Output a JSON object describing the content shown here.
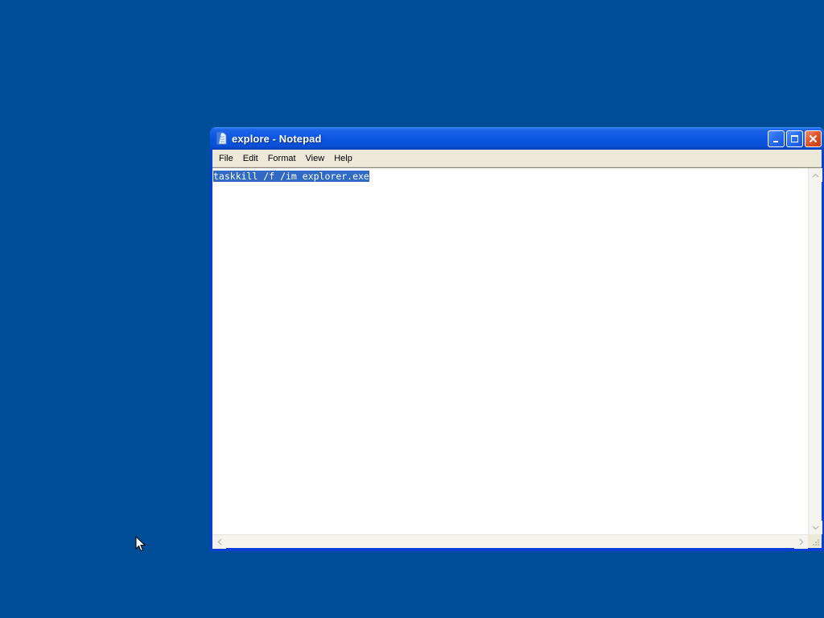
{
  "window": {
    "title": "explore - Notepad",
    "icon": "notepad-icon"
  },
  "menu": {
    "items": [
      "File",
      "Edit",
      "Format",
      "View",
      "Help"
    ]
  },
  "editor": {
    "content": "taskkill /f /im explorer.exe",
    "selection": "all"
  },
  "colors": {
    "desktop": "#004e98",
    "selection": "#316ac5",
    "titlebar": "#0a4fd6",
    "close_button": "#e2562e"
  }
}
